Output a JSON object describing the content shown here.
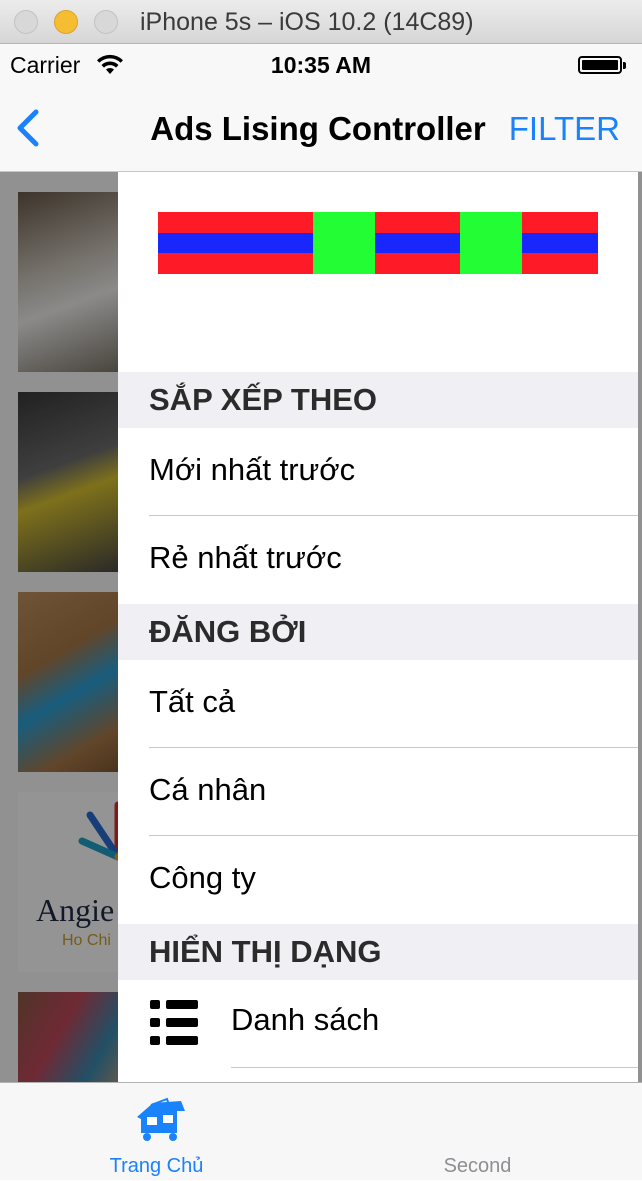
{
  "window": {
    "title": "iPhone 5s – iOS 10.2 (14C89)"
  },
  "status_bar": {
    "carrier": "Carrier",
    "time": "10:35 AM",
    "battery_level": 1.0
  },
  "nav": {
    "title": "Ads Lising Controller",
    "filter_label": "FILTER",
    "back_icon": "chevron-left-icon"
  },
  "background_list": {
    "thumbnail_count": 5,
    "logo_text": "Angie",
    "logo_subtext": "Ho Chi"
  },
  "drawer": {
    "sort": {
      "header": "SẮP XẾP THEO",
      "options": [
        {
          "label": "Mới nhất trước"
        },
        {
          "label": "Rẻ nhất trước"
        }
      ]
    },
    "posted_by": {
      "header": "ĐĂNG BỞI",
      "options": [
        {
          "label": "Tất cả"
        },
        {
          "label": "Cá nhân"
        },
        {
          "label": "Công ty"
        }
      ]
    },
    "display": {
      "header": "HIỂN THỊ DẠNG",
      "options": [
        {
          "label": "Danh sách",
          "icon": "list-icon"
        }
      ]
    },
    "banner_colors": {
      "red": "#fe1a27",
      "blue": "#1a27fc",
      "green": "#23fe34"
    }
  },
  "tabbar": {
    "tabs": [
      {
        "label": "Trang Chủ",
        "icon": "house-icon",
        "selected": true
      },
      {
        "label": "Second",
        "selected": false
      }
    ]
  },
  "colors": {
    "accent": "#1a82fb",
    "section_bg": "#efeff4"
  }
}
